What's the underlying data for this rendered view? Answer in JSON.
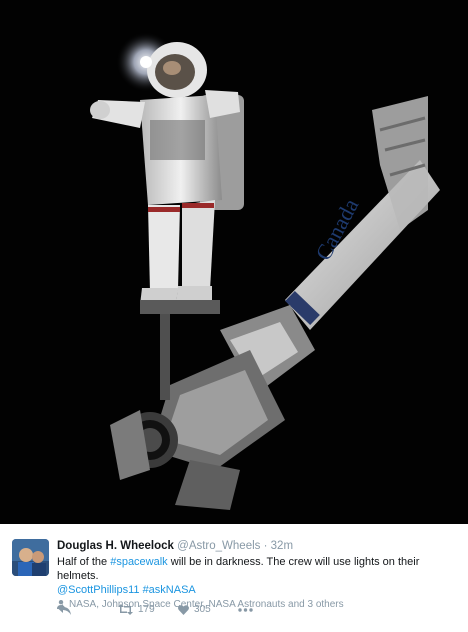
{
  "tweet": {
    "author_name": "Douglas H. Wheelock",
    "author_handle": "@Astro_Wheels",
    "separator": "·",
    "time": "32m",
    "text_part1": "Half of the ",
    "hashtag_spacewalk": "#spacewalk",
    "text_part2": " will be in darkness. The crew will use lights on their helmets.",
    "mention": "@ScottPhillips11",
    "hashtag_asknasa": "#askNASA",
    "liked_by": "NASA, Johnson Space Center, NASA Astronauts and 3 others",
    "retweet_count": "179",
    "like_count": "305"
  },
  "photo": {
    "arm_label": "Canada"
  },
  "icons": {
    "reply": "reply-icon",
    "retweet": "retweet-icon",
    "like": "heart-icon",
    "more": "more-icon",
    "person": "person-icon"
  },
  "colors": {
    "link": "#1b95e0",
    "muted": "#8899a6",
    "text": "#14171a"
  }
}
